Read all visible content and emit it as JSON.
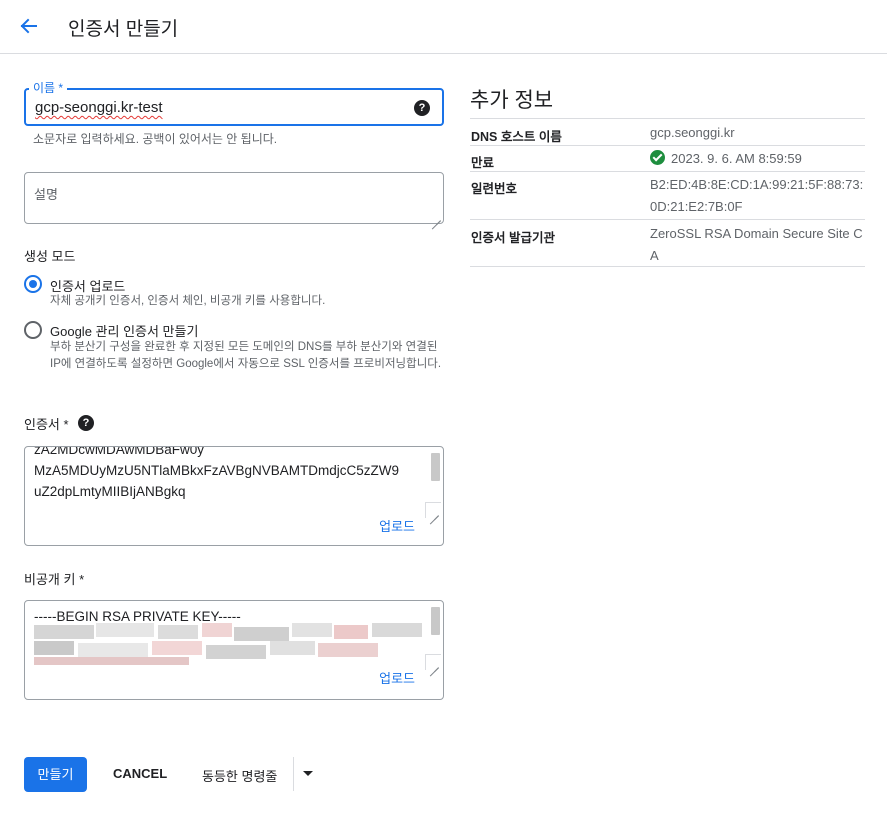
{
  "header": {
    "title": "인증서 만들기"
  },
  "form": {
    "name_label": "이름 *",
    "name_value": "gcp-seonggi.kr-test",
    "name_hint": "소문자로 입력하세요. 공백이 있어서는 안 됩니다.",
    "description_placeholder": "설명",
    "mode_label": "생성 모드",
    "mode_options": [
      {
        "title": "인증서 업로드",
        "description": "자체 공개키 인증서, 인증서 체인, 비공개 키를 사용합니다.",
        "selected": true
      },
      {
        "title": "Google 관리 인증서 만들기",
        "description": "부하 분산기 구성을 완료한 후 지정된 모든 도메인의 DNS를 부하 분산기와 연결된 IP에 연결하도록 설정하면 Google에서 자동으로 SSL 인증서를 프로비저닝합니다.",
        "selected": false
      }
    ],
    "certificate_label": "인증서 *",
    "certificate_lines": [
      "zA2MDcwMDAwMDBaFw0y",
      "MzA5MDUyMzU5NTlaMBkxFzAVBgNVBAMTDmdjcC5zZW9",
      "uZ2dpLmtyMIIBIjANBgkq"
    ],
    "private_key_label": "비공개 키 *",
    "private_key_first_line": "-----BEGIN RSA PRIVATE KEY-----",
    "upload_label": "업로드",
    "help_glyph": "?"
  },
  "actions": {
    "create": "만들기",
    "cancel": "CANCEL",
    "equivalent_command": "동등한 명령줄"
  },
  "info": {
    "title": "추가 정보",
    "rows": [
      {
        "key": "DNS 호스트 이름",
        "value": "gcp.seonggi.kr"
      },
      {
        "key": "만료",
        "value": "2023. 9. 6. AM 8:59:59"
      },
      {
        "key": "일련번호",
        "value": "B2:ED:4B:8E:CD:1A:99:21:5F:88:73:0D:21:E2:7B:0F"
      },
      {
        "key": "인증서 발급기관",
        "value": "ZeroSSL RSA Domain Secure Site CA"
      }
    ]
  },
  "colors": {
    "accent": "#1a73e8",
    "success": "#1e8e3e"
  }
}
